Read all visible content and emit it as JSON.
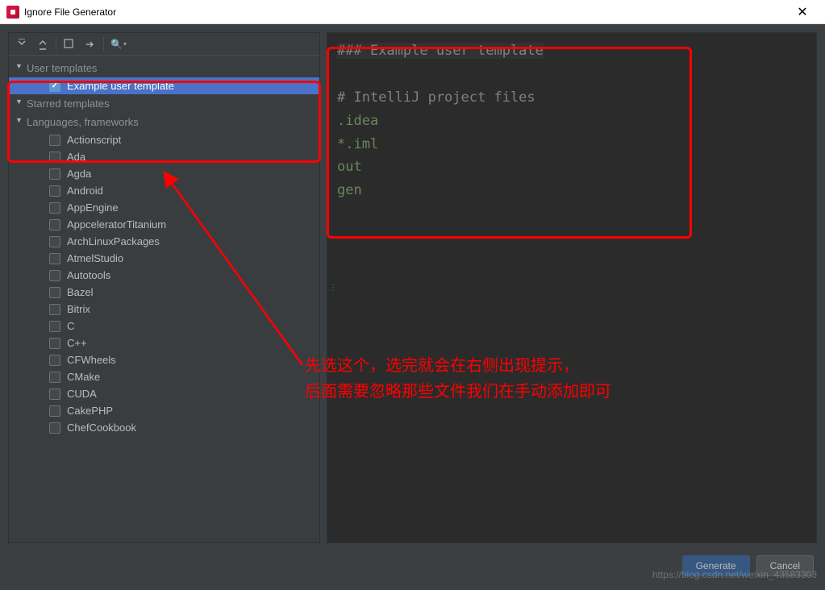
{
  "window": {
    "title": "Ignore File Generator"
  },
  "toolbar": {
    "expand_all": "⇊",
    "collapse_all": "⇈",
    "deselect": "☐",
    "arrow": "→",
    "search": "🔍▾"
  },
  "tree": {
    "sections": {
      "user": "User templates",
      "starred": "Starred templates",
      "languages": "Languages, frameworks"
    },
    "user_items": [
      {
        "label": "Example user template",
        "checked": true,
        "selected": true
      }
    ],
    "language_items": [
      {
        "label": "Actionscript"
      },
      {
        "label": "Ada"
      },
      {
        "label": "Agda"
      },
      {
        "label": "Android"
      },
      {
        "label": "AppEngine"
      },
      {
        "label": "AppceleratorTitanium"
      },
      {
        "label": "ArchLinuxPackages"
      },
      {
        "label": "AtmelStudio"
      },
      {
        "label": "Autotools"
      },
      {
        "label": "Bazel"
      },
      {
        "label": "Bitrix"
      },
      {
        "label": "C"
      },
      {
        "label": "C++"
      },
      {
        "label": "CFWheels"
      },
      {
        "label": "CMake"
      },
      {
        "label": "CUDA"
      },
      {
        "label": "CakePHP"
      },
      {
        "label": "ChefCookbook"
      }
    ]
  },
  "preview": {
    "title": "### Example user template",
    "comment": "# IntelliJ project files",
    "p1": ".idea",
    "p2": "*.iml",
    "p3": "out",
    "p4": "gen"
  },
  "annotation": {
    "line1": "先选这个，选完就会在右侧出现提示，",
    "line2": "后面需要忽略那些文件我们在手动添加即可"
  },
  "buttons": {
    "generate": "Generate",
    "cancel": "Cancel"
  },
  "watermark": "https://blog.csdn.net/weixin_43583303"
}
